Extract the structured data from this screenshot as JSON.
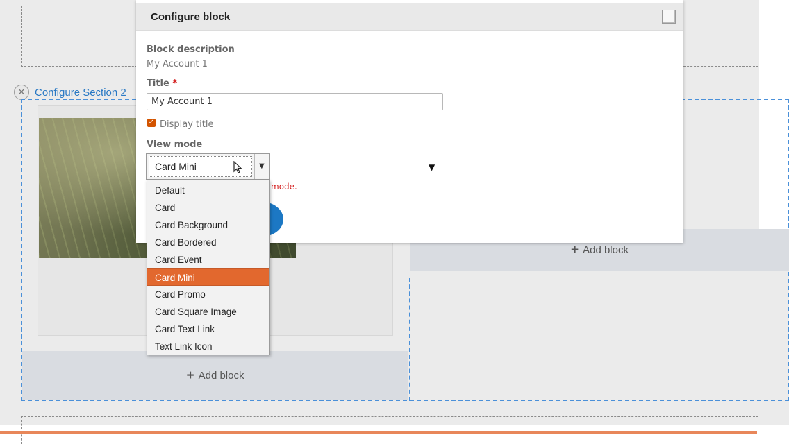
{
  "layout_builder": {
    "configure_section_label": "Configure Section 2",
    "add_block_left": "Add block",
    "add_block_right": "Add block",
    "close_glyph": "✕"
  },
  "modal": {
    "title": "Configure block",
    "block_description_label": "Block description",
    "block_description_value": "My Account 1",
    "title_label": "Title",
    "required_mark": "*",
    "title_value": "My Account 1",
    "display_title_label": "Display title",
    "display_title_checked": true,
    "view_mode_label": "View mode",
    "view_mode_selected": "Card Mini",
    "error_fragment": "mode."
  },
  "dropdown": {
    "options": [
      "Default",
      "Card",
      "Card Background",
      "Card Bordered",
      "Card Event",
      "Card Mini",
      "Card Promo",
      "Card Square Image",
      "Card Text Link",
      "Text Link Icon"
    ],
    "highlighted_index": 5
  },
  "icons": {
    "plus": "+",
    "caret": "▼",
    "check": "✓"
  },
  "colors": {
    "accent_orange": "#e2682e",
    "link_blue": "#2a79c4",
    "error_red": "#d42121",
    "button_blue": "#1c78c4"
  }
}
